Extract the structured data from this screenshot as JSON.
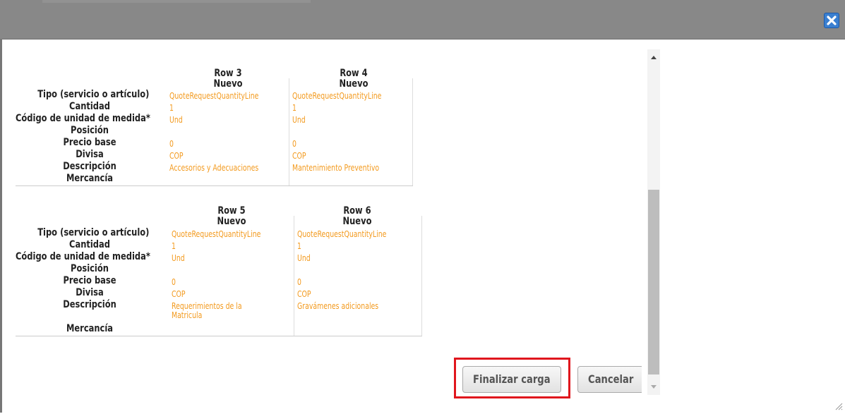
{
  "dialog": {
    "close_icon": "close-icon",
    "accent": "#3a7fd0",
    "value_color": "#f39a1e"
  },
  "labels": {
    "tipo": "Tipo (servicio o artículo)",
    "cantidad": "Cantidad",
    "codigo": "Código de unidad de medida*",
    "posicion": "Posición",
    "precio": "Precio base",
    "divisa": "Divisa",
    "descripcion": "Descripción",
    "mercancia": "Mercancía"
  },
  "rows": [
    {
      "title": "Row 3",
      "status": "Nuevo",
      "tipo": "QuoteRequestQuantityLine",
      "cantidad": "1",
      "codigo": "Und",
      "precio": "0",
      "divisa": "COP",
      "descripcion": "Accesorios y Adecuaciones"
    },
    {
      "title": "Row 4",
      "status": "Nuevo",
      "tipo": "QuoteRequestQuantityLine",
      "cantidad": "1",
      "codigo": "Und",
      "precio": "0",
      "divisa": "COP",
      "descripcion": "Mantenimiento Preventivo"
    },
    {
      "title": "Row 5",
      "status": "Nuevo",
      "tipo": "QuoteRequestQuantityLine",
      "cantidad": "1",
      "codigo": "Und",
      "precio": "0",
      "divisa": "COP",
      "descripcion": "Requerimientos de la",
      "descripcion2": "Matricula"
    },
    {
      "title": "Row 6",
      "status": "Nuevo",
      "tipo": "QuoteRequestQuantityLine",
      "cantidad": "1",
      "codigo": "Und",
      "precio": "0",
      "divisa": "COP",
      "descripcion": "Gravámenes adicionales"
    }
  ],
  "buttons": {
    "finalize": "Finalizar carga",
    "cancel": "Cancelar"
  }
}
